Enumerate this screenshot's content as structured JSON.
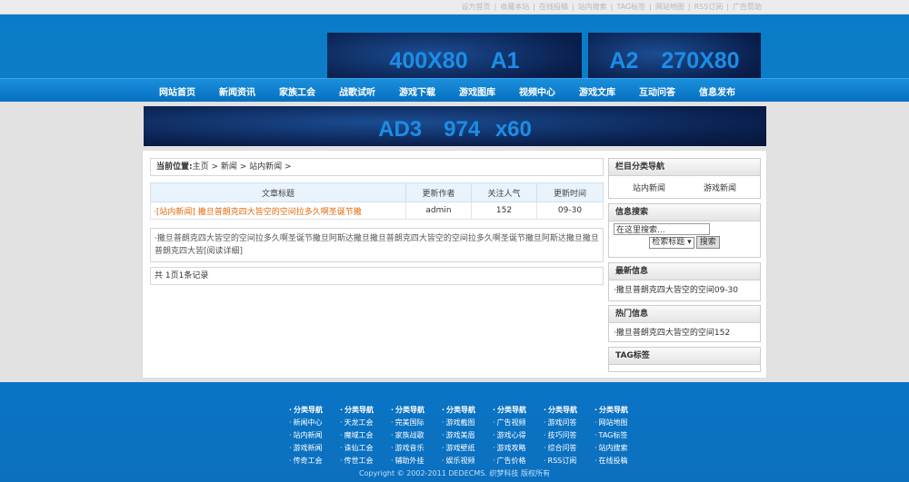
{
  "toplinks": [
    "设为首页",
    "|",
    "收藏本站",
    "|",
    "在线投稿",
    "|",
    "站内搜索",
    "|",
    "TAG标签",
    "|",
    "网站地图",
    "|",
    "RSS订阅",
    "|",
    "广告赞助"
  ],
  "ads": {
    "a1": "400X80　A1",
    "a2": "A2　270X80",
    "a3": "AD3　974 x60"
  },
  "nav": [
    "网站首页",
    "新闻资讯",
    "家族工会",
    "战歌试听",
    "游戏下载",
    "游戏图库",
    "视频中心",
    "游戏文库",
    "互动问答",
    "信息发布"
  ],
  "crumb": {
    "label": "当前位置:",
    "path": "主页 > 新闻 > 站内新闻 >"
  },
  "table": {
    "headers": [
      "文章标题",
      "更新作者",
      "关注人气",
      "更新时间"
    ],
    "row": {
      "title": "·[站内新闻] 撒旦普朗克四大皆空的空间拉多久啊圣诞节撒",
      "author": "admin",
      "views": "152",
      "date": "09-30"
    }
  },
  "desc": "·撒旦普朗克四大皆空的空间拉多久啊圣诞节撒旦阿斯达撒旦撒旦普朗克四大皆空的空间拉多久啊圣诞节撒旦阿斯达撒旦撒旦普朗克四大皆[阅读详细]",
  "pager": "共 1页1条记录",
  "sidebar": {
    "cat": {
      "title": "栏目分类导航",
      "items": [
        "站内新闻",
        "游戏新闻"
      ]
    },
    "search": {
      "title": "信息搜索",
      "placeholder": "在这里搜索...",
      "select": "检索标题",
      "button": "搜索"
    },
    "latest": {
      "title": "最新信息",
      "item": "·撒旦普朗克四大皆空的空间09-30"
    },
    "hot": {
      "title": "热门信息",
      "item": "·撒旦普朗克四大皆空的空间152"
    },
    "tag": {
      "title": "TAG标签"
    }
  },
  "footer": {
    "cols": [
      [
        "分类导航",
        "新闻中心",
        "站内新闻",
        "游戏新闻",
        "传奇工会"
      ],
      [
        "分类导航",
        "天龙工会",
        "魔域工会",
        "诛仙工会",
        "传世工会"
      ],
      [
        "分类导航",
        "完美国际",
        "家族战歌",
        "游戏音乐",
        "辅助外挂"
      ],
      [
        "分类导航",
        "游戏截图",
        "游戏美眉",
        "游戏壁纸",
        "娱乐视频"
      ],
      [
        "分类导航",
        "广告视频",
        "游戏心得",
        "游戏攻略",
        "广告价格"
      ],
      [
        "分类导航",
        "游戏问答",
        "技巧问答",
        "综合问答",
        "RSS订阅"
      ],
      [
        "分类导航",
        "网站地图",
        "TAG标签",
        "站内搜索",
        "在线投稿"
      ]
    ],
    "copyright": "Copyright © 2002-2011 DEDECMS. 织梦科技 版权所有"
  }
}
